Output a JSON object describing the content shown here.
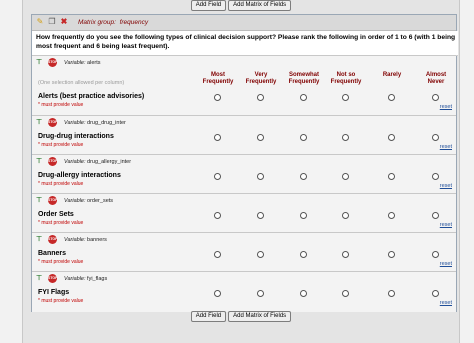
{
  "buttons": {
    "add_field": "Add Field",
    "add_matrix": "Add Matrix of Fields"
  },
  "matrix_group": {
    "label": "Matrix group:",
    "name": "frequency",
    "icons": [
      "pencil-icon",
      "copy-icon",
      "delete-icon"
    ]
  },
  "question": "How frequently do you see the following types of clinical decision support? Please rank the following in order of 1 to 6 (with 1 being most frequent and 6 being least frequent).",
  "hint": "(One selection allowed per column)",
  "columns": [
    {
      "line1": "Most",
      "line2": "Frequently"
    },
    {
      "line1": "Very",
      "line2": "Frequently"
    },
    {
      "line1": "Somewhat",
      "line2": "Frequently"
    },
    {
      "line1": "Not so",
      "line2": "Frequently"
    },
    {
      "line1": "",
      "line2": "Rarely"
    },
    {
      "line1": "Almost",
      "line2": "Never"
    }
  ],
  "variable_label": "Variable:",
  "stop_label": "STOP",
  "required_text": "* must provide value",
  "reset_label": "reset",
  "rows": [
    {
      "variable": "alerts",
      "label": "Alerts (best practice advisories)"
    },
    {
      "variable": "drug_drug_inter",
      "label": "Drug-drug interactions"
    },
    {
      "variable": "drug_allergy_inter",
      "label": "Drug-allergy interactions"
    },
    {
      "variable": "order_sets",
      "label": "Order Sets"
    },
    {
      "variable": "banners",
      "label": "Banners"
    },
    {
      "variable": "fyi_flags",
      "label": "FYI Flags"
    }
  ],
  "colors": {
    "header_text": "#800000",
    "required_text": "#c00000",
    "link": "#1f4e99",
    "stop": "#c62828"
  }
}
